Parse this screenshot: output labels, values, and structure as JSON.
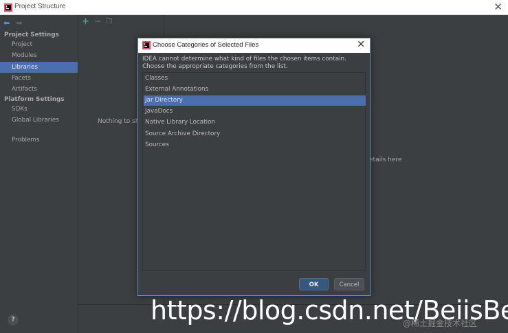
{
  "window": {
    "title": "Project Structure"
  },
  "sidebar": {
    "project_settings_header": "Project Settings",
    "platform_settings_header": "Platform Settings",
    "items": [
      {
        "label": "Project"
      },
      {
        "label": "Modules"
      },
      {
        "label": "Libraries",
        "selected": true
      },
      {
        "label": "Facets"
      },
      {
        "label": "Artifacts"
      },
      {
        "label": "SDKs"
      },
      {
        "label": "Global Libraries"
      },
      {
        "label": "Problems"
      }
    ],
    "help": "?"
  },
  "middle": {
    "empty_text": "Nothing to sho"
  },
  "right": {
    "text": "etails here"
  },
  "dialog": {
    "title": "Choose Categories of Selected Files",
    "message_line1": "IDEA cannot determine what kind of files the chosen items contain.",
    "message_line2": "Choose the appropriate categories from the list.",
    "items": [
      {
        "label": "Classes"
      },
      {
        "label": "External Annotations"
      },
      {
        "label": "Jar Directory",
        "selected": true
      },
      {
        "label": "JavaDocs"
      },
      {
        "label": "Native Library Location"
      },
      {
        "label": "Source Archive Directory"
      },
      {
        "label": "Sources"
      }
    ],
    "ok_label": "OK",
    "cancel_label": "Cancel"
  },
  "watermark": {
    "text": "https://blog.csdn.net/BeiisBei",
    "secondary": "@稀土掘金技术社区"
  },
  "colors": {
    "selection": "#4b6eaf",
    "background": "#3c3f41",
    "ok_button": "#365880"
  }
}
